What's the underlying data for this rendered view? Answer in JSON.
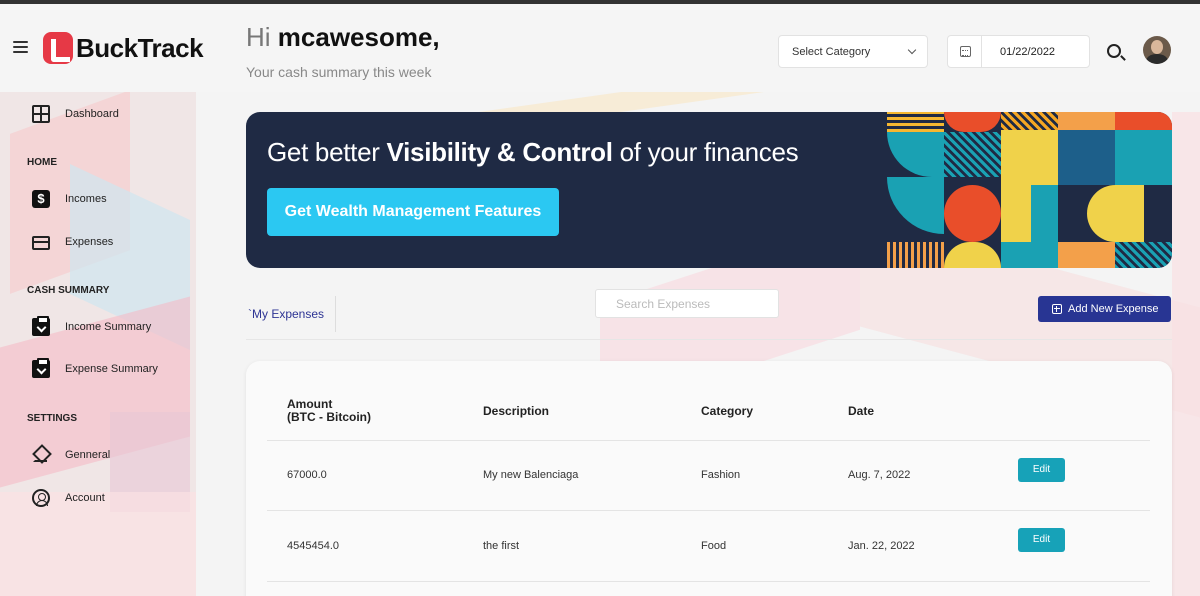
{
  "app": {
    "name": "BuckTrack"
  },
  "header": {
    "greeting_prefix": "Hi ",
    "username": "mcawesome,",
    "subtitle": "Your cash summary this week",
    "category_select": "Select Category",
    "date_value": "01/22/2022"
  },
  "sidebar": {
    "dashboard": "Dashboard",
    "sections": {
      "home": "HOME",
      "cash_summary": "CASH SUMMARY",
      "settings": "SETTINGS"
    },
    "items": {
      "incomes": "Incomes",
      "expenses": "Expenses",
      "income_summary": "Income Summary",
      "expense_summary": "Expense Summary",
      "general": "Genneral",
      "account": "Account"
    }
  },
  "banner": {
    "title_start": "Get better ",
    "title_bold": "Visibility & Control",
    "title_end": " of your finances",
    "button": "Get Wealth Management Features"
  },
  "toolbar": {
    "tab": "`My Expenses",
    "search_placeholder": "Search Expenses",
    "add_button": "Add New Expense"
  },
  "table": {
    "headers": {
      "amount_line1": "Amount",
      "amount_line2": "(BTC - Bitcoin)",
      "description": "Description",
      "category": "Category",
      "date": "Date"
    },
    "edit_label": "Edit",
    "rows": [
      {
        "amount": "67000.0",
        "description": "My new Balenciaga",
        "category": "Fashion",
        "date": "Aug. 7, 2022"
      },
      {
        "amount": "4545454.0",
        "description": "the first",
        "category": "Food",
        "date": "Jan. 22, 2022"
      }
    ]
  },
  "colors": {
    "accent_blue": "#283593",
    "banner_bg": "#1f2a44",
    "cta_cyan": "#2bc8f2",
    "edit_teal": "#17a2b8",
    "logo_red": "#e63946"
  }
}
